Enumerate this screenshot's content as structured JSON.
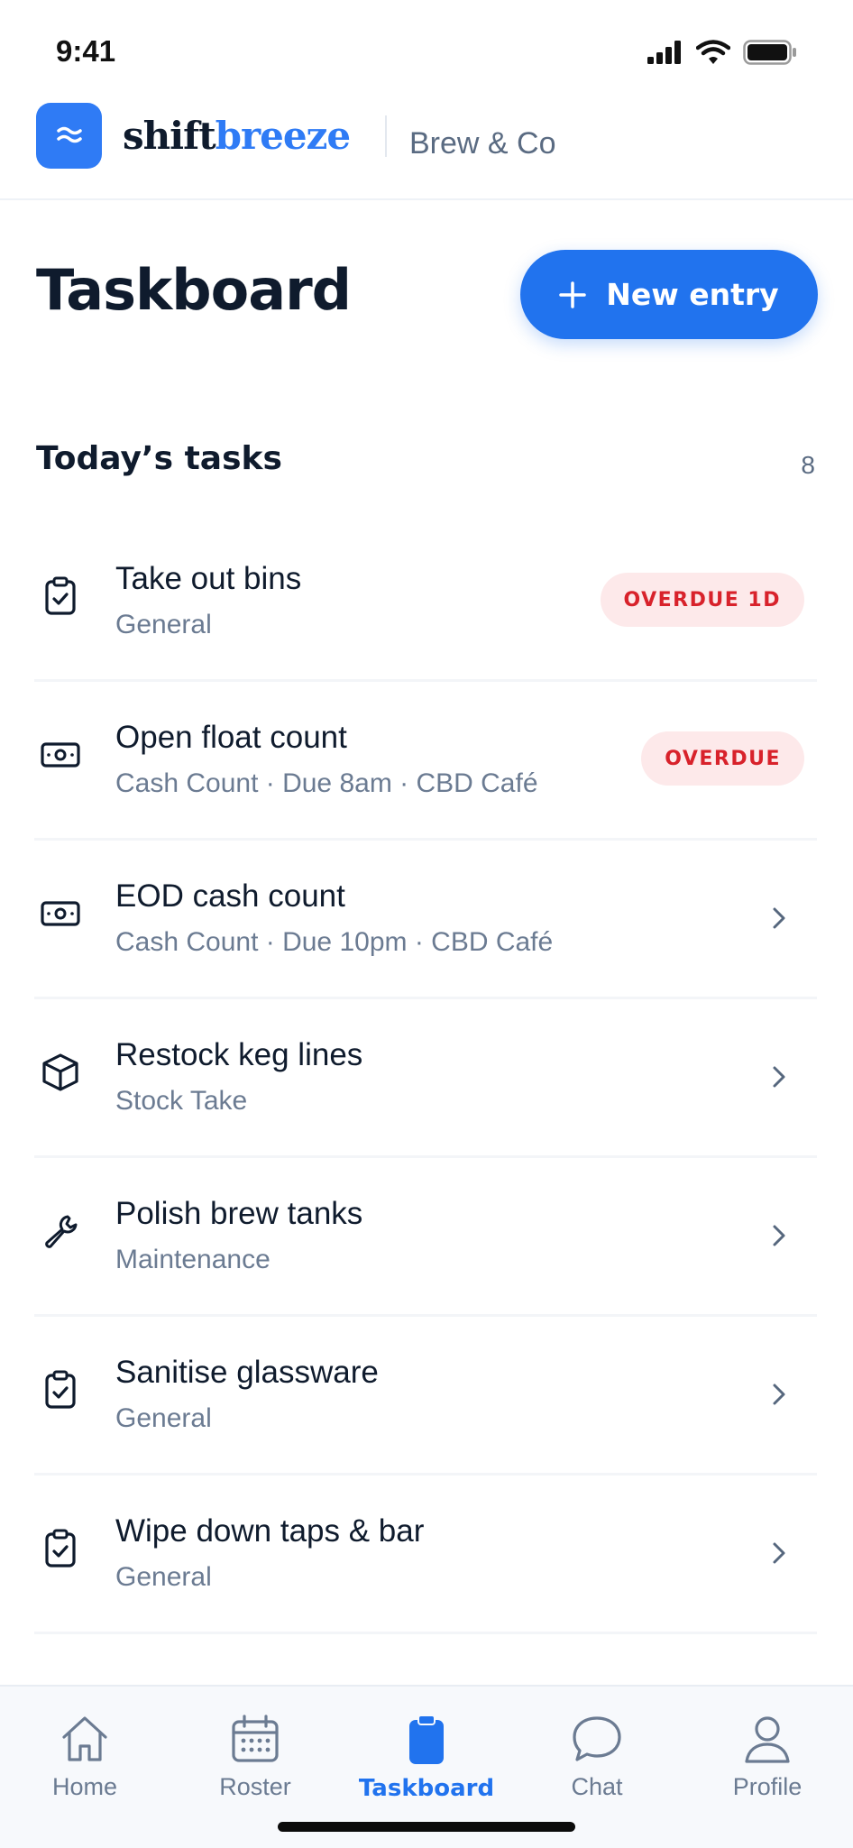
{
  "status_bar": {
    "time": "9:41"
  },
  "brand": {
    "name_part1": "shift",
    "name_part2": "breeze",
    "venue": "Brew & Co"
  },
  "page": {
    "title": "Taskboard",
    "new_entry_label": "New entry"
  },
  "section": {
    "title": "Today’s tasks",
    "count": "8"
  },
  "tasks": [
    {
      "title": "Take out bins",
      "subtitle": "General",
      "icon": "clipboard-check-icon",
      "badge": "OVERDUE 1D"
    },
    {
      "title": "Open float count",
      "subtitle": "Cash Count · Due 8am · CBD Café",
      "icon": "cash-icon",
      "badge": "OVERDUE"
    },
    {
      "title": "EOD cash count",
      "subtitle": "Cash Count · Due 10pm · CBD Café",
      "icon": "cash-icon",
      "badge": null
    },
    {
      "title": "Restock keg lines",
      "subtitle": "Stock Take",
      "icon": "box-icon",
      "badge": null
    },
    {
      "title": "Polish brew tanks",
      "subtitle": "Maintenance",
      "icon": "wrench-icon",
      "badge": null
    },
    {
      "title": "Sanitise glassware",
      "subtitle": "General",
      "icon": "clipboard-check-icon",
      "badge": null
    },
    {
      "title": "Wipe down taps & bar",
      "subtitle": "General",
      "icon": "clipboard-check-icon",
      "badge": null
    }
  ],
  "tab_bar": {
    "home": "Home",
    "roster": "Roster",
    "taskboard": "Taskboard",
    "chat": "Chat",
    "profile": "Profile"
  },
  "colors": {
    "accent": "#2173ee",
    "overdue_text": "#d8222b",
    "overdue_bg": "#fde9ea",
    "text": "#0f1b2d",
    "muted": "#6b7b92"
  }
}
